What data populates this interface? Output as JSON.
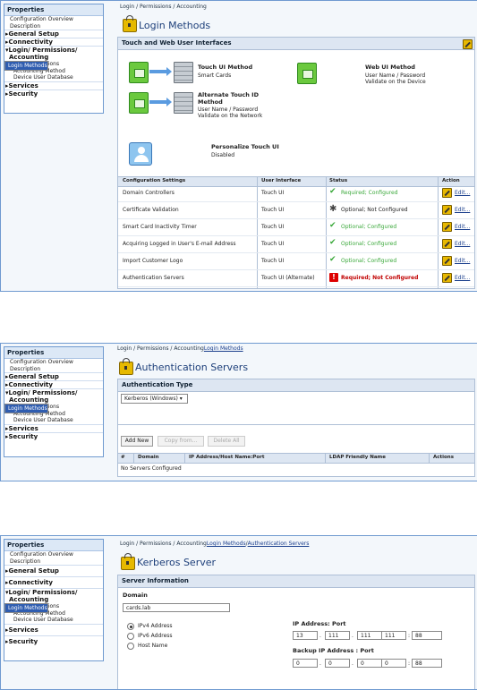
{
  "sidebar": {
    "title": "Properties",
    "top_items": [
      "Configuration Overview",
      "Description"
    ],
    "general_setup": "General Setup",
    "connectivity": "Connectivity",
    "login_section": [
      "Login/ Permissions/",
      "Accounting"
    ],
    "login_subitems": [
      "Login Methods",
      "User Permissions",
      "Accounting Method",
      "Device User Database"
    ],
    "services": "Services",
    "security": "Security"
  },
  "panel1": {
    "breadcrumb": "Login / Permissions / Accounting",
    "title": "Login Methods",
    "section_title": "Touch and Web User Interfaces",
    "touch_ui_method_title": "Touch UI Method",
    "touch_ui_method_value": "Smart Cards",
    "alt_method_title_1": "Alternate Touch ID",
    "alt_method_title_2": "Method",
    "alt_method_value_1": "User Name / Password",
    "alt_method_value_2": "Validate on the Network",
    "web_ui_method_title": "Web UI Method",
    "web_ui_method_value_1": "User Name / Password",
    "web_ui_method_value_2": "Validate on the Device",
    "personalize_title": "Personalize Touch UI",
    "personalize_value": "Disabled",
    "table_headers": [
      "Configuration Settings",
      "User Interface",
      "Status",
      "Action"
    ],
    "rows": [
      {
        "setting": "Domain Controllers",
        "ui": "Touch UI",
        "status": "Required; Configured",
        "kind": "ok-bold",
        "action": "Edit..."
      },
      {
        "setting": "Certificate Validation",
        "ui": "Touch UI",
        "status": "Optional; Not Configured",
        "kind": "gear",
        "action": "Edit..."
      },
      {
        "setting": "Smart Card Inactivity Timer",
        "ui": "Touch UI",
        "status": "Optional; Configured",
        "kind": "ok",
        "action": "Edit..."
      },
      {
        "setting": "Acquiring Logged in User's E-mail Address",
        "ui": "Touch UI",
        "status": "Optional; Configured",
        "kind": "ok",
        "action": "Edit..."
      },
      {
        "setting": "Import Customer Logo",
        "ui": "Touch UI",
        "status": "Optional; Configured",
        "kind": "ok",
        "action": "Edit..."
      },
      {
        "setting": "Authentication Servers",
        "ui": "Touch UI (Alternate)",
        "status": "Required; Not Configured",
        "kind": "bad",
        "action": "Edit..."
      }
    ]
  },
  "panel2": {
    "breadcrumb_plain": "Login / Permissions / Accounting",
    "breadcrumb_link": "Login Methods",
    "title": "Authentication Servers",
    "section_title": "Authentication Type",
    "auth_type": "Kerberos (Windows)",
    "buttons": [
      "Add New",
      "Copy from...",
      "Delete All"
    ],
    "table_headers": [
      "#",
      "Domain",
      "IP Address/Host Name:Port",
      "LDAP Friendly Name",
      "Actions"
    ],
    "empty_text": "No Servers Configured"
  },
  "panel3": {
    "breadcrumb_plain": "Login / Permissions / Accounting",
    "breadcrumb_link1": "Login Methods",
    "breadcrumb_link2": "Authentication Servers",
    "title": "Kerberos Server",
    "section_title": "Server Information",
    "domain_label": "Domain",
    "domain_value": "cards.lab",
    "radio_options": [
      "IPv4 Address",
      "IPv6 Address",
      "Host Name"
    ],
    "ip_label": "IP Address: Port",
    "ip_octets": [
      "13",
      "111",
      "111",
      "111"
    ],
    "ip_port": "88",
    "backup_label": "Backup IP Address : Port",
    "backup_octets": [
      "0",
      "0",
      "0",
      "0"
    ],
    "backup_port": "88"
  }
}
